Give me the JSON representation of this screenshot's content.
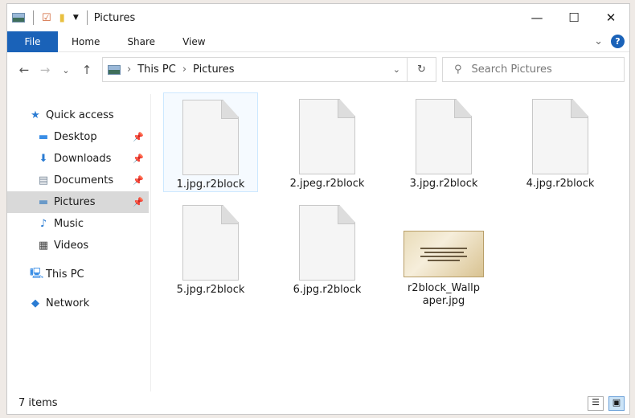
{
  "window": {
    "title": "Pictures",
    "minimize": "—",
    "maximize": "☐",
    "close": "✕"
  },
  "ribbon": {
    "tabs": [
      "File",
      "Home",
      "Share",
      "View"
    ],
    "expand": "⌄",
    "help": "?"
  },
  "nav": {
    "back": "←",
    "forward": "→",
    "recent": "⌄",
    "up": "↑",
    "path": [
      "This PC",
      "Pictures"
    ],
    "refresh": "↻",
    "search_placeholder": "Search Pictures"
  },
  "sidebar": {
    "items": [
      {
        "label": "Quick access",
        "icon": "star-icon",
        "glyph": "★",
        "color": "#2b7cd3",
        "pinned": false
      },
      {
        "label": "Desktop",
        "icon": "desktop-icon",
        "glyph": "▬",
        "color": "#3a8ee6",
        "pinned": true
      },
      {
        "label": "Downloads",
        "icon": "download-icon",
        "glyph": "⬇",
        "color": "#2b7cd3",
        "pinned": true
      },
      {
        "label": "Documents",
        "icon": "documents-icon",
        "glyph": "▤",
        "color": "#7a8a9a",
        "pinned": true
      },
      {
        "label": "Pictures",
        "icon": "pictures-icon",
        "glyph": "▬",
        "color": "#6a9ac8",
        "pinned": true,
        "selected": true
      },
      {
        "label": "Music",
        "icon": "music-icon",
        "glyph": "♪",
        "color": "#2b7cd3",
        "pinned": false
      },
      {
        "label": "Videos",
        "icon": "videos-icon",
        "glyph": "▦",
        "color": "#444",
        "pinned": false
      },
      {
        "label": "This PC",
        "icon": "computer-icon",
        "glyph": "🖳",
        "color": "#3a8ee6",
        "pinned": false
      },
      {
        "label": "Network",
        "icon": "network-icon",
        "glyph": "◆",
        "color": "#2b7cd3",
        "pinned": false
      }
    ]
  },
  "files": [
    {
      "name": "1.jpg.r2block",
      "type": "doc",
      "selected": true
    },
    {
      "name": "2.jpeg.r2block",
      "type": "doc"
    },
    {
      "name": "3.jpg.r2block",
      "type": "doc"
    },
    {
      "name": "4.jpg.r2block",
      "type": "doc"
    },
    {
      "name": "5.jpg.r2block",
      "type": "doc"
    },
    {
      "name": "6.jpg.r2block",
      "type": "doc"
    },
    {
      "name": "r2block_Wallpaper.jpg",
      "type": "image"
    }
  ],
  "status": {
    "count": "7 items"
  },
  "colors": {
    "accent": "#1a62b8"
  }
}
